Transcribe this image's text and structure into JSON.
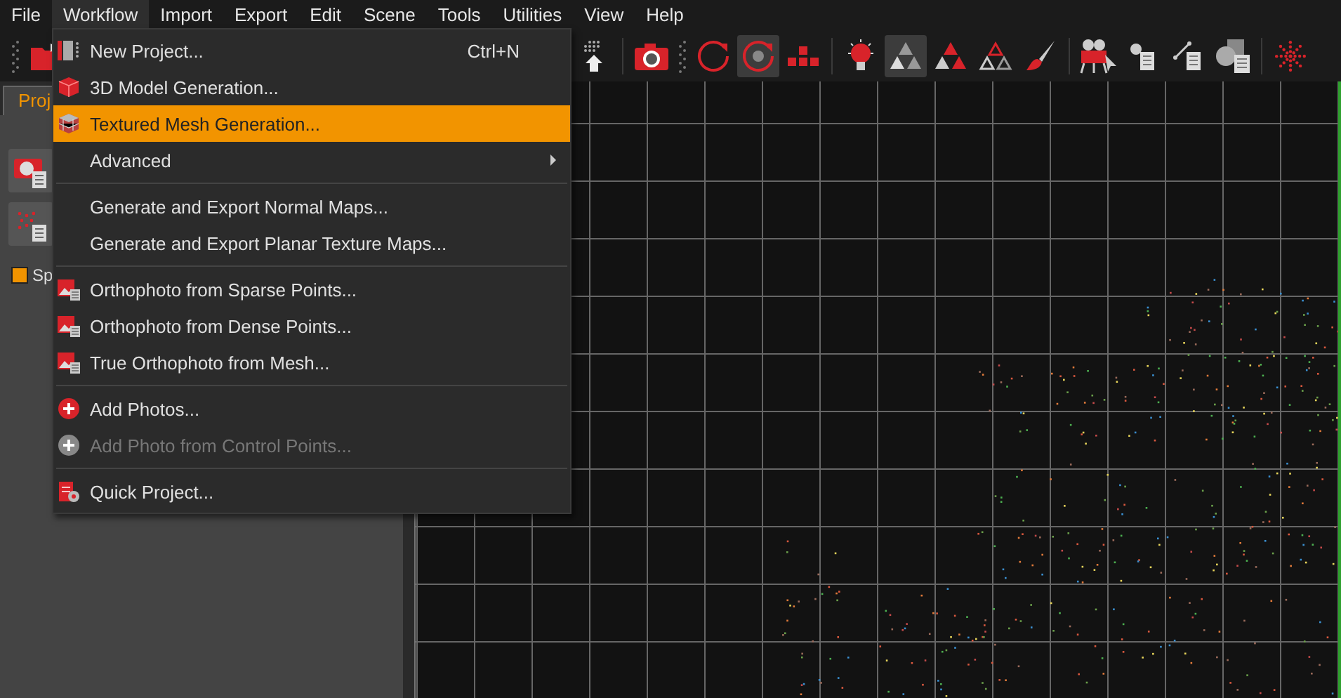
{
  "menubar": [
    {
      "label": "File",
      "selected": false
    },
    {
      "label": "Workflow",
      "selected": true
    },
    {
      "label": "Import",
      "selected": false
    },
    {
      "label": "Export",
      "selected": false
    },
    {
      "label": "Edit",
      "selected": false
    },
    {
      "label": "Scene",
      "selected": false
    },
    {
      "label": "Tools",
      "selected": false
    },
    {
      "label": "Utilities",
      "selected": false
    },
    {
      "label": "View",
      "selected": false
    },
    {
      "label": "Help",
      "selected": false
    }
  ],
  "toolbar": {
    "left": [
      {
        "kind": "folder",
        "selected": false
      }
    ],
    "right": [
      {
        "kind": "upload-points",
        "selected": false
      },
      {
        "kind": "sep"
      },
      {
        "kind": "camera",
        "selected": false
      },
      {
        "kind": "grip"
      },
      {
        "kind": "rotate",
        "selected": false
      },
      {
        "kind": "rotate-dot",
        "selected": true
      },
      {
        "kind": "keys",
        "selected": false
      },
      {
        "kind": "sep"
      },
      {
        "kind": "bulb",
        "selected": false
      },
      {
        "kind": "triangles",
        "selected": true
      },
      {
        "kind": "triangles-filled",
        "selected": false
      },
      {
        "kind": "triangles-outline",
        "selected": false
      },
      {
        "kind": "brush",
        "selected": false
      },
      {
        "kind": "sep"
      },
      {
        "kind": "movie-camera",
        "selected": false
      },
      {
        "kind": "doc-dot",
        "selected": false
      },
      {
        "kind": "doc-line",
        "selected": false
      },
      {
        "kind": "doc-shapes",
        "selected": false
      },
      {
        "kind": "sep"
      },
      {
        "kind": "sphere-dots",
        "selected": false
      }
    ]
  },
  "left_panel": {
    "tab": {
      "label": "Proj",
      "selected": true
    },
    "buttons": [
      {
        "kind": "camera-doc"
      },
      {
        "kind": "dots-doc"
      }
    ],
    "layer": {
      "label": "Sp",
      "color": "#f29400"
    }
  },
  "menu": [
    {
      "kind": "new-project",
      "label": "New Project...",
      "shortcut": "Ctrl+N",
      "selected": false,
      "disabled": false,
      "submenu": false
    },
    {
      "kind": "cube",
      "label": "3D Model Generation...",
      "selected": false,
      "disabled": false,
      "submenu": false
    },
    {
      "kind": "textured-cube",
      "label": "Textured Mesh Generation...",
      "selected": true,
      "disabled": false,
      "submenu": false
    },
    {
      "kind": "plain",
      "label": "Advanced",
      "selected": false,
      "disabled": false,
      "submenu": true
    },
    {
      "kind": "separator"
    },
    {
      "kind": "plain",
      "label": "Generate and Export Normal Maps...",
      "selected": false,
      "disabled": false,
      "submenu": false
    },
    {
      "kind": "plain",
      "label": "Generate and Export Planar Texture Maps...",
      "selected": false,
      "disabled": false,
      "submenu": false
    },
    {
      "kind": "separator"
    },
    {
      "kind": "ortho",
      "label": "Orthophoto from Sparse Points...",
      "selected": false,
      "disabled": false,
      "submenu": false
    },
    {
      "kind": "ortho",
      "label": "Orthophoto from Dense Points...",
      "selected": false,
      "disabled": false,
      "submenu": false
    },
    {
      "kind": "ortho",
      "label": "True Orthophoto from Mesh...",
      "selected": false,
      "disabled": false,
      "submenu": false
    },
    {
      "kind": "separator"
    },
    {
      "kind": "add",
      "label": "Add Photos...",
      "selected": false,
      "disabled": false,
      "submenu": false
    },
    {
      "kind": "add",
      "label": "Add Photo from Control Points...",
      "selected": false,
      "disabled": true,
      "submenu": false
    },
    {
      "kind": "separator"
    },
    {
      "kind": "quick",
      "label": "Quick Project...",
      "selected": false,
      "disabled": false,
      "submenu": false
    }
  ]
}
